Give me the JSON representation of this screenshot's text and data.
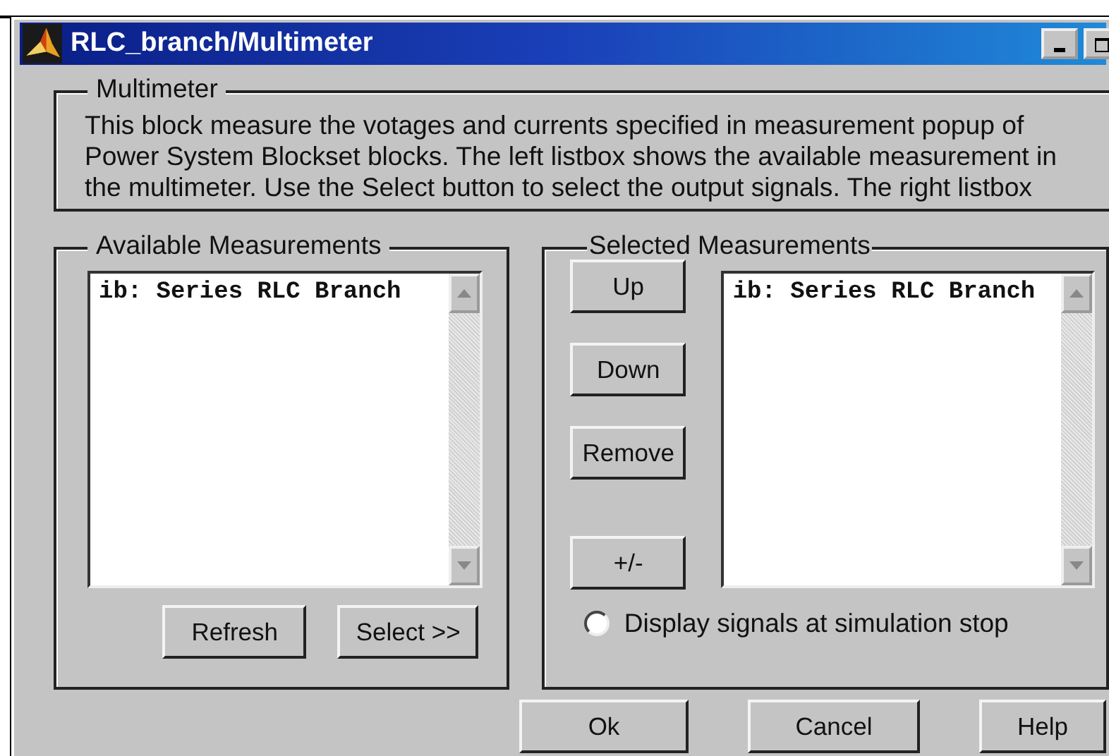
{
  "window": {
    "title": "RLC_branch/Multimeter"
  },
  "description": {
    "legend": "Multimeter",
    "lines": [
      "This block measure the votages and currents specified in measurement popup of",
      "Power System Blockset blocks. The left listbox shows the available measurement in",
      "the multimeter. Use the Select button to select the output signals. The right listbox"
    ]
  },
  "available": {
    "legend": "Available Measurements",
    "items": [
      "ib: Series RLC Branch"
    ],
    "buttons": [
      "Refresh",
      "Select >>"
    ]
  },
  "selected_panel": {
    "legend": "Selected Measurements",
    "buttons": [
      "Up",
      "Down",
      "Remove",
      "+/-"
    ],
    "items": [
      "ib: Series RLC Branch"
    ],
    "option": {
      "label": "Display signals at simulation stop",
      "checked": false
    }
  },
  "buttons": [
    "Ok",
    "Cancel",
    "Help"
  ]
}
